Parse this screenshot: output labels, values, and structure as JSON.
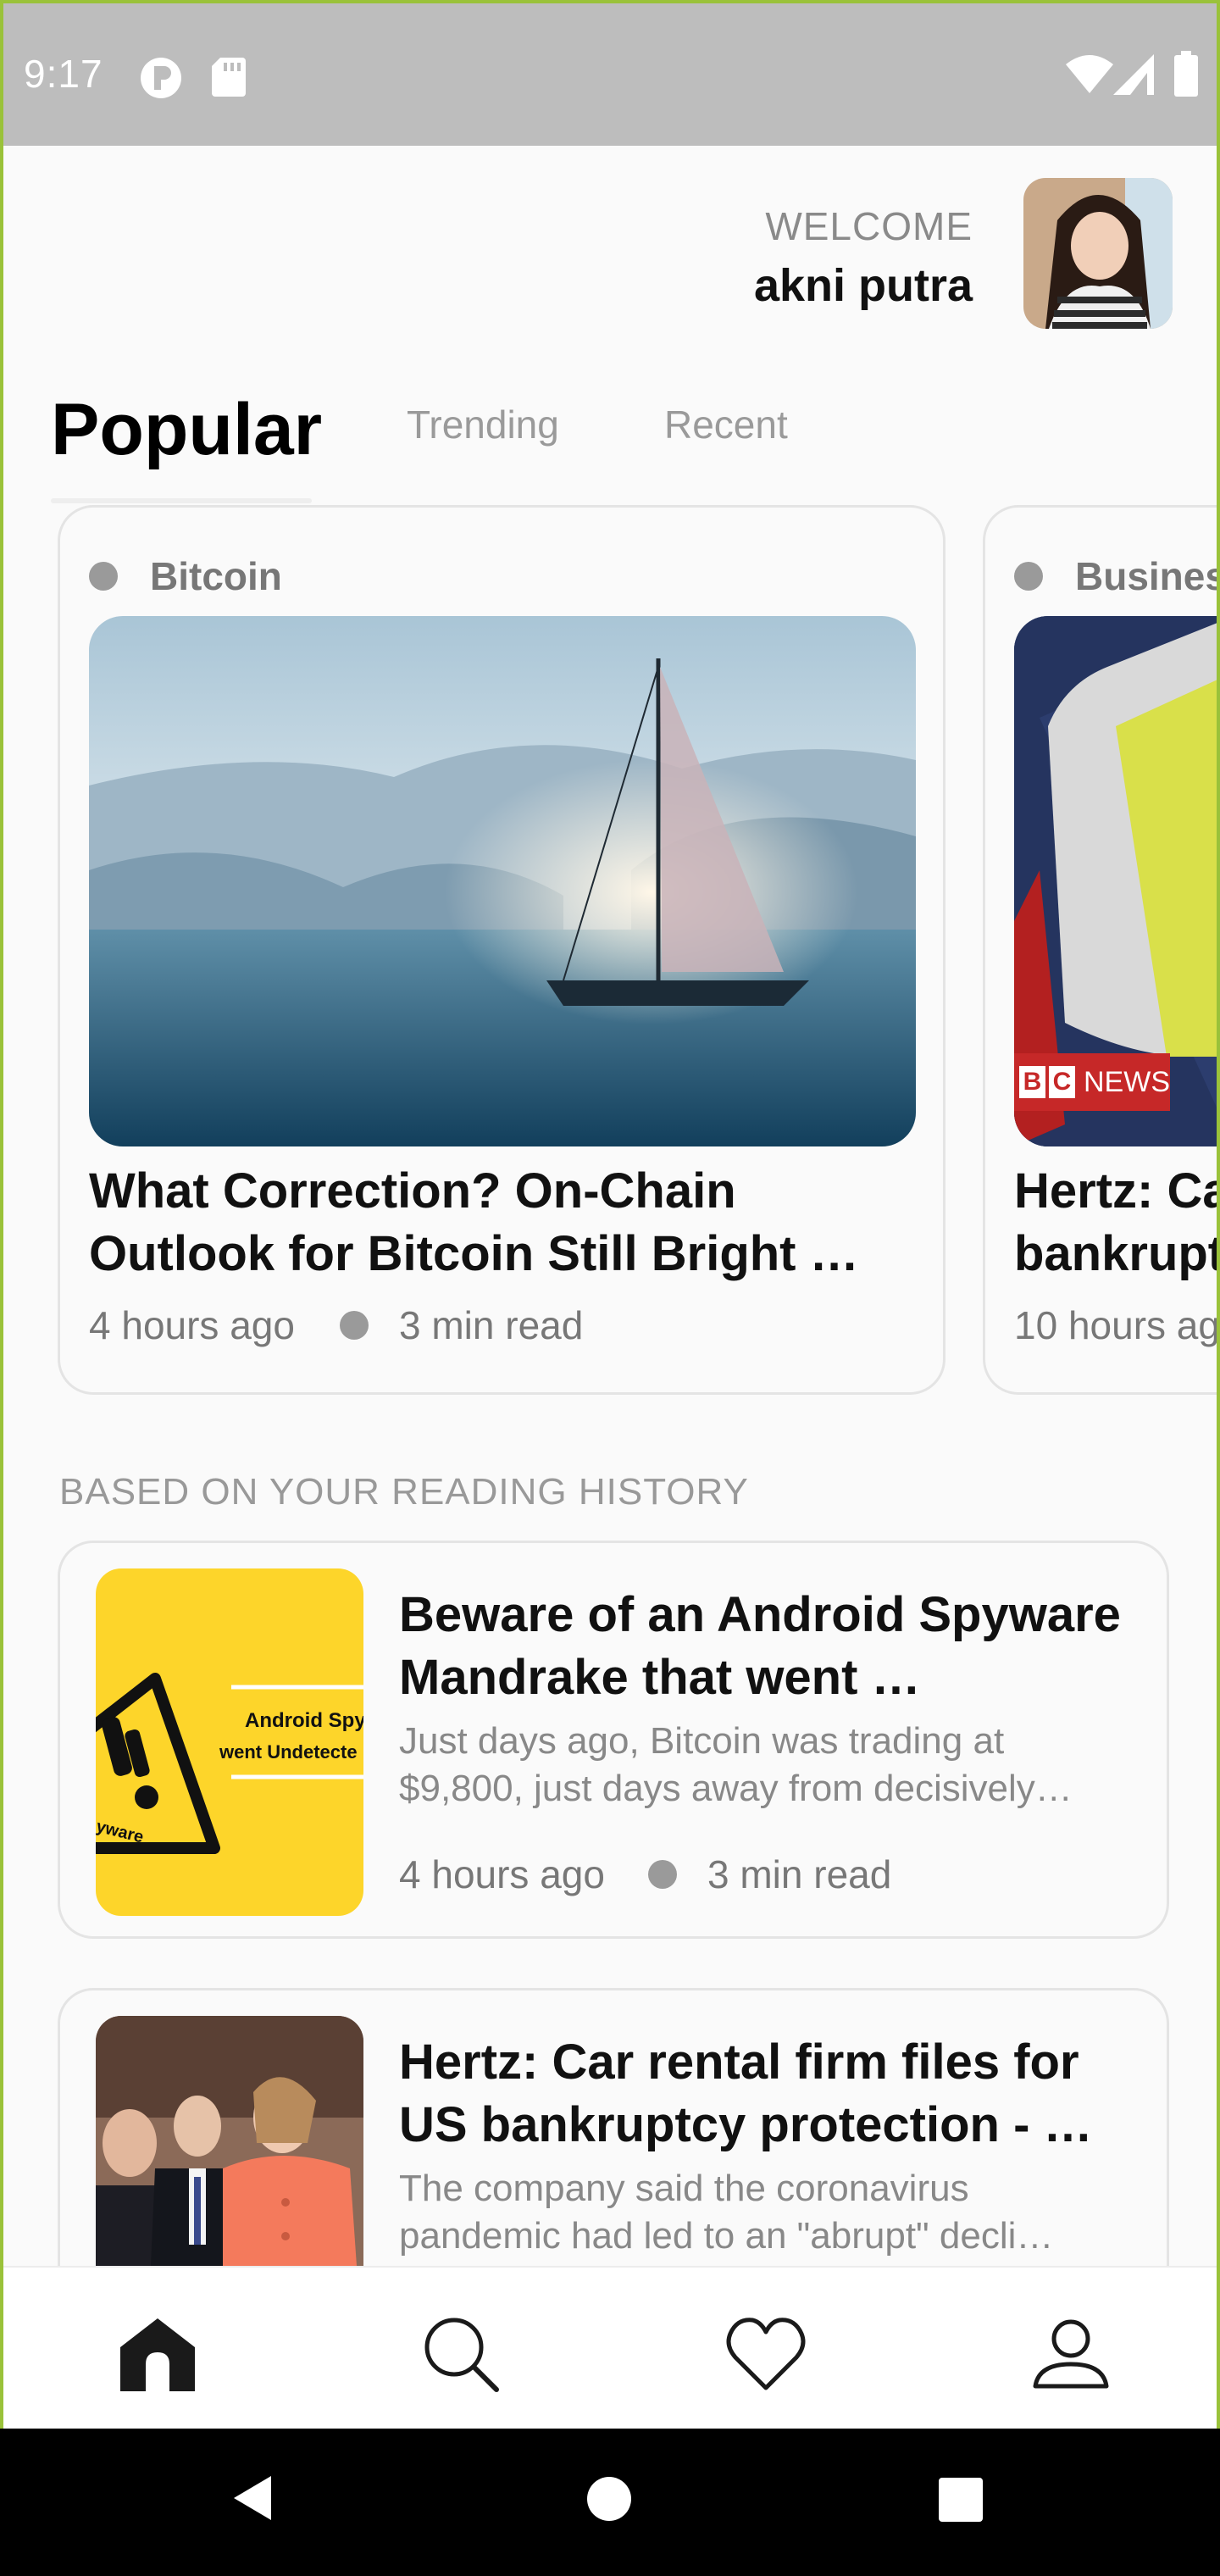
{
  "status_bar": {
    "time": "9:17"
  },
  "header": {
    "welcome_label": "WELCOME",
    "user_name": "akni putra"
  },
  "tabs": [
    {
      "label": "Popular",
      "active": true
    },
    {
      "label": "Trending",
      "active": false
    },
    {
      "label": "Recent",
      "active": false
    }
  ],
  "popular_cards": [
    {
      "category": "Bitcoin",
      "title_line1": "What Correction? On-Chain",
      "title_line2": "Outlook for Bitcoin Still Bright …",
      "time": "4 hours ago",
      "read_time": "3 min read"
    },
    {
      "category": "Busines",
      "title_line1": "Hertz: Ca",
      "title_line2": "bankrupt",
      "time": "10 hours ag",
      "badge": "NEWS",
      "badge_letters": [
        "B",
        "C"
      ]
    }
  ],
  "section_label": "BASED ON YOUR READING HISTORY",
  "history": [
    {
      "title_line1": "Beware of an Android Spyware",
      "title_line2": "Mandrake that went …",
      "desc_line1": "Just days ago, Bitcoin was trading at",
      "desc_line2": "$9,800, just days away from decisively…",
      "time": "4 hours ago",
      "read_time": "3 min read",
      "thumb_text1": "Android Spy",
      "thumb_text2": "went Undetecte",
      "thumb_text3": "yware"
    },
    {
      "title_line1": "Hertz: Car rental firm files for",
      "title_line2": "US bankruptcy protection - …",
      "desc_line1": "The company said the coronavirus",
      "desc_line2": "pandemic had led to an \"abrupt\" decli…"
    }
  ],
  "bottom_nav": [
    {
      "icon": "home-icon"
    },
    {
      "icon": "search-icon"
    },
    {
      "icon": "heart-icon"
    },
    {
      "icon": "profile-icon"
    }
  ],
  "colors": {
    "accent_border": "#9ac23a",
    "status_bar": "#bdbdbd",
    "thumb_yellow": "#fdd52a",
    "bbc_red": "#c62828"
  }
}
